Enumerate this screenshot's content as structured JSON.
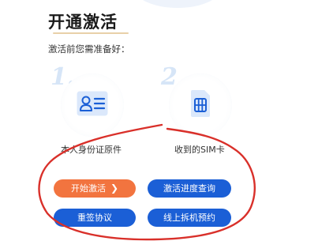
{
  "header": {
    "title": "开通激活"
  },
  "intro": {
    "text": "激活前您需准备好："
  },
  "steps": [
    {
      "number": "1.",
      "caption": "本人身份证原件",
      "icon": "id-card-icon"
    },
    {
      "number": "2.",
      "caption": "收到的SIM卡",
      "icon": "sim-card-icon"
    }
  ],
  "actions": {
    "start_activation": "开始激活",
    "progress_query": "激活进度查询",
    "resign_agreement": "重签协议",
    "online_appointment": "线上拆机预约"
  },
  "colors": {
    "primary_blue": "#1b5fd6",
    "orange": "#f2743f",
    "annotation_red": "#d9302a",
    "step_number": "#d6e5f7"
  }
}
